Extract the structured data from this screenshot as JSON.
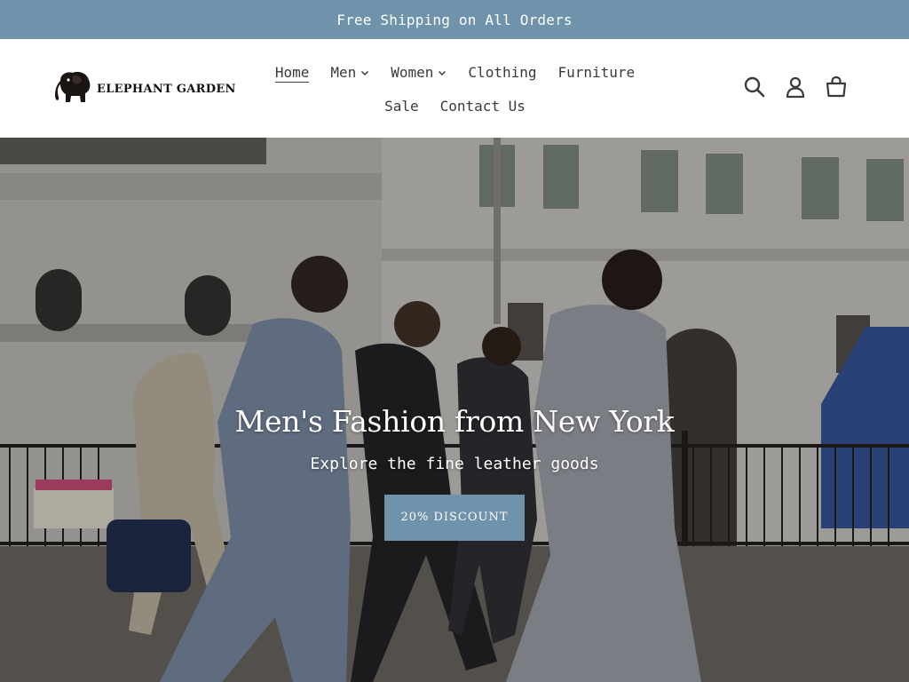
{
  "announcement": {
    "text": "Free Shipping on All Orders"
  },
  "header": {
    "logo_text": "ELEPHANT GARDEN",
    "nav": {
      "home": "Home",
      "men": "Men",
      "women": "Women",
      "clothing": "Clothing",
      "furniture": "Furniture",
      "sale": "Sale",
      "contact": "Contact Us"
    },
    "icons": [
      "search-icon",
      "account-icon",
      "cart-icon"
    ]
  },
  "hero": {
    "title": "Men's Fashion from New York",
    "subtitle": "Explore the fine leather goods",
    "button_label": "20% DISCOUNT"
  },
  "colors": {
    "accent": "#6e93aa",
    "text": "#3a3a3a",
    "background": "#ffffff"
  }
}
